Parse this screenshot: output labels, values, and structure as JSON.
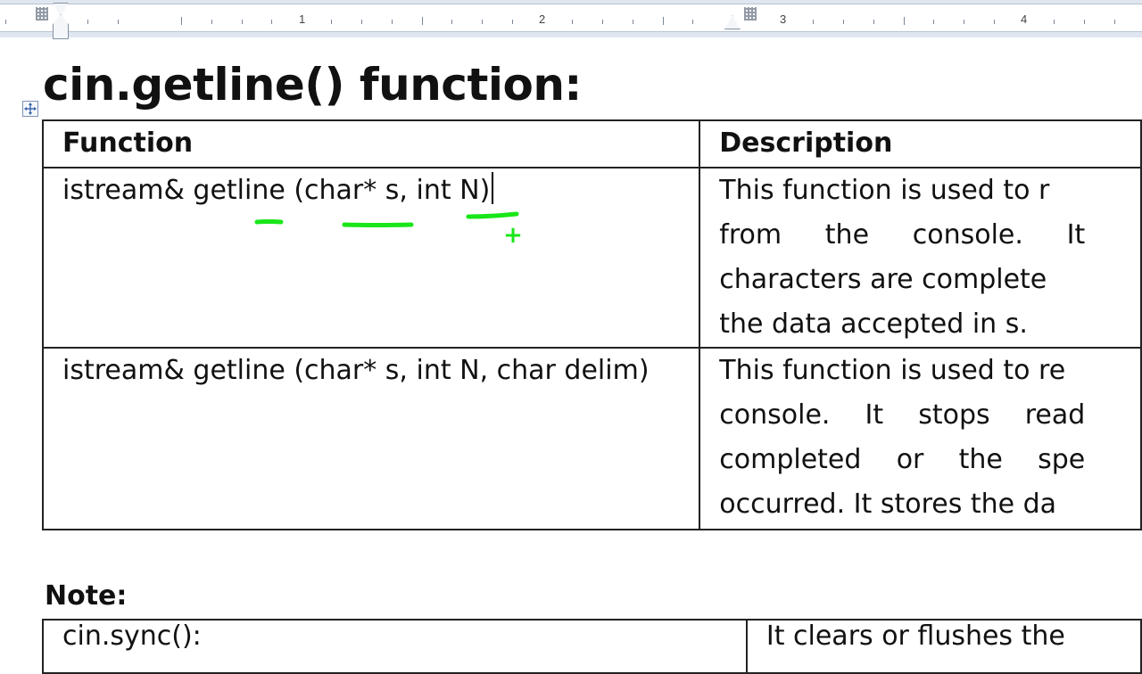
{
  "ruler": {
    "numbers": [
      "1",
      "2",
      "3",
      "4"
    ]
  },
  "document": {
    "heading": "cin.getline() function:",
    "table": {
      "header": {
        "function": "Function",
        "description": "Description"
      },
      "rows": [
        {
          "function": "istream& getline (char* s, int N)",
          "description_lines": [
            "This function is used to r",
            "from the console. It",
            "characters are complete",
            "the data accepted in s."
          ]
        },
        {
          "function": "istream& getline (char* s, int N, char delim)",
          "description_lines": [
            "This function is used to re",
            "console. It stops read",
            "completed or the spe",
            "occurred. It stores the da"
          ]
        }
      ]
    },
    "note_label": "Note:",
    "note_table": {
      "row": {
        "function": "cin.sync():",
        "description": "It clears or flushes the"
      }
    }
  },
  "annotations": {
    "ink_color": "#19e619",
    "plus_mark": "+"
  }
}
